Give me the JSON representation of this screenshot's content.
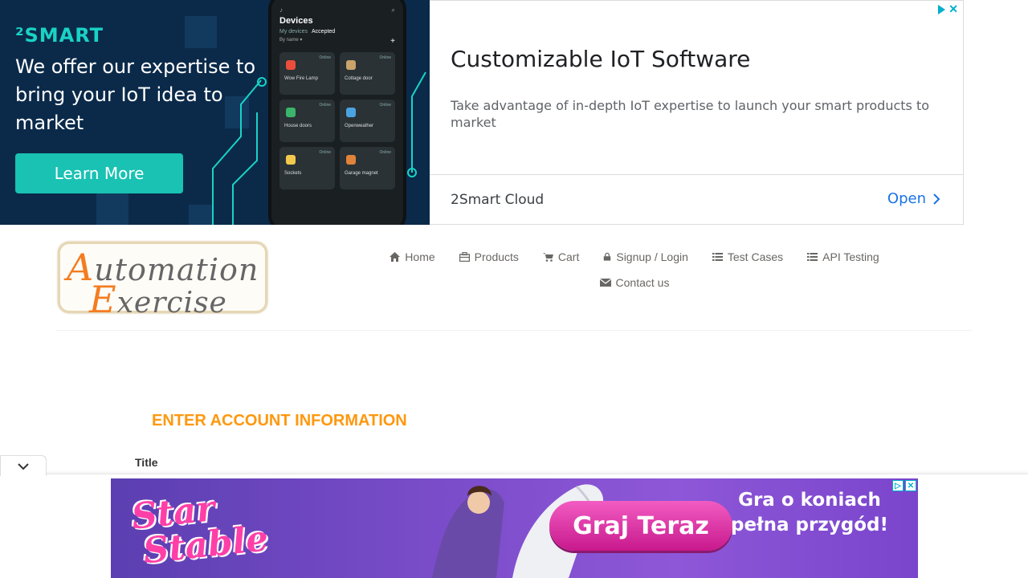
{
  "top_ad": {
    "brand": "²SMART",
    "headline": "We offer our expertise to bring your IoT idea to market",
    "cta_label": "Learn More",
    "phone": {
      "title": "Devices",
      "tab_my": "My devices",
      "tab_accepted": "Accepted",
      "sort": "By name ▾",
      "tiles": [
        {
          "name": "Wow Fire Lamp",
          "status": "Online",
          "color": "#e94e3c"
        },
        {
          "name": "Cottage door",
          "status": "Online",
          "color": "#c9a36b"
        },
        {
          "name": "House doors",
          "status": "Online",
          "color": "#3bb56b"
        },
        {
          "name": "Openweather",
          "status": "Online",
          "color": "#4aa3e0"
        },
        {
          "name": "Sockets",
          "status": "Online",
          "color": "#f2c94c"
        },
        {
          "name": "Garage magnet",
          "status": "Online",
          "color": "#e0833a"
        }
      ]
    },
    "title": "Customizable IoT Software",
    "description": "Take advantage of in-depth IoT expertise to launch your smart products to market",
    "advertiser": "2Smart Cloud",
    "open_label": "Open"
  },
  "header": {
    "logo_line1_cap": "A",
    "logo_line1_rest": "utomation",
    "logo_line2_cap": "E",
    "logo_line2_rest": "xercise",
    "nav": [
      {
        "label": "Home",
        "icon": "home-icon"
      },
      {
        "label": "Products",
        "icon": "products-icon"
      },
      {
        "label": "Cart",
        "icon": "cart-icon"
      },
      {
        "label": "Signup / Login",
        "icon": "lock-icon"
      },
      {
        "label": "Test Cases",
        "icon": "list-icon"
      },
      {
        "label": "API Testing",
        "icon": "list-icon"
      },
      {
        "label": "Contact us",
        "icon": "envelope-icon"
      }
    ]
  },
  "form": {
    "heading": "ENTER ACCOUNT INFORMATION",
    "title_label": "Title"
  },
  "bottom_ad": {
    "brand_line1": "Star",
    "brand_line2": "Stable",
    "cta_label": "Graj Teraz",
    "tagline": "Gra o koniach pełna przygód!"
  },
  "colors": {
    "accent": "#fe980f",
    "logo_orange": "#f47c20",
    "ad_teal": "#19c2b3",
    "link_blue": "#1a73e8"
  }
}
